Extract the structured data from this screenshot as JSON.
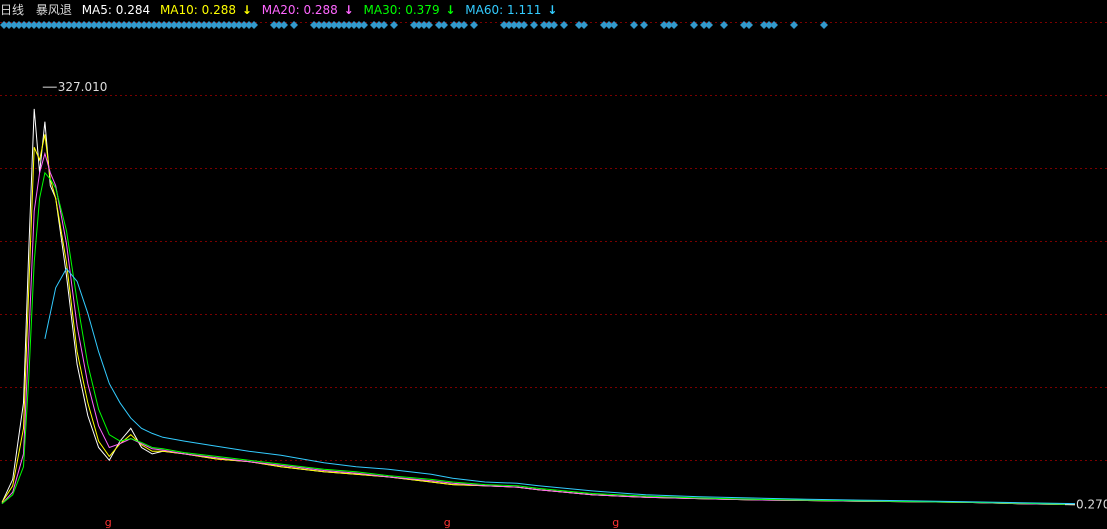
{
  "header": {
    "period_label": "日线",
    "indicator_name": "暴风退",
    "ma_items": [
      {
        "label": "MA5:",
        "value": "0.284",
        "arrow": "",
        "color": "#ffffff"
      },
      {
        "label": "MA10:",
        "value": "0.288",
        "arrow": "↓",
        "color": "#ffff00"
      },
      {
        "label": "MA20:",
        "value": "0.288",
        "arrow": "↓",
        "color": "#ff66ff"
      },
      {
        "label": "MA30:",
        "value": "0.379",
        "arrow": "↓",
        "color": "#00ff00"
      },
      {
        "label": "MA60:",
        "value": "1.111",
        "arrow": "↓",
        "color": "#33ccff"
      }
    ]
  },
  "chart_data": {
    "type": "line",
    "title": "",
    "xlabel": "",
    "ylabel": "",
    "ylim": [
      0,
      360
    ],
    "grid": true,
    "x": [
      0,
      0.01,
      0.02,
      0.025,
      0.03,
      0.035,
      0.04,
      0.045,
      0.05,
      0.06,
      0.07,
      0.08,
      0.09,
      0.1,
      0.11,
      0.12,
      0.13,
      0.14,
      0.15,
      0.17,
      0.2,
      0.23,
      0.26,
      0.28,
      0.3,
      0.33,
      0.36,
      0.4,
      0.42,
      0.45,
      0.48,
      0.5,
      0.55,
      0.6,
      0.65,
      0.7,
      0.75,
      0.8,
      0.85,
      0.9,
      0.95,
      1.0
    ],
    "series": [
      {
        "values": [
          2,
          20,
          80,
          200,
          310,
          260,
          300,
          250,
          240,
          180,
          110,
          70,
          45,
          35,
          50,
          60,
          45,
          40,
          42,
          40,
          36,
          34,
          30,
          28,
          26,
          24,
          22,
          18,
          16,
          15,
          14,
          12,
          8,
          6,
          5,
          4,
          3.5,
          3,
          2.5,
          2,
          1,
          0.28
        ],
        "color": "#ffffff"
      },
      {
        "values": [
          2,
          15,
          60,
          170,
          280,
          270,
          290,
          255,
          240,
          190,
          120,
          80,
          50,
          38,
          48,
          55,
          47,
          42,
          42,
          40,
          36,
          34,
          30,
          28,
          26,
          24,
          22,
          18,
          16,
          15,
          14,
          12,
          8,
          6,
          5,
          4,
          3.5,
          3,
          2.5,
          2,
          1,
          0.29
        ],
        "color": "#ffff00"
      },
      {
        "values": [
          1,
          10,
          40,
          130,
          230,
          260,
          275,
          260,
          250,
          205,
          140,
          95,
          62,
          45,
          48,
          52,
          48,
          44,
          43,
          40,
          37,
          34,
          31,
          29,
          27,
          25,
          22,
          19,
          17,
          15,
          14,
          12,
          8,
          6,
          5,
          4,
          3.5,
          3,
          2.5,
          2,
          1,
          0.29
        ],
        "color": "#ff66ff"
      },
      {
        "values": [
          1,
          8,
          30,
          100,
          190,
          240,
          260,
          255,
          248,
          215,
          160,
          110,
          75,
          55,
          50,
          52,
          49,
          45,
          44,
          41,
          38,
          35,
          32,
          30,
          28,
          26,
          23,
          20,
          18,
          16,
          15,
          13,
          9,
          7,
          5.5,
          4.5,
          3.8,
          3.2,
          2.7,
          2.2,
          1.3,
          0.38
        ],
        "color": "#00ff00"
      },
      {
        "values": [
          null,
          null,
          null,
          null,
          null,
          null,
          130,
          150,
          170,
          185,
          175,
          150,
          120,
          95,
          80,
          68,
          60,
          56,
          53,
          50,
          46,
          42,
          39,
          36,
          33,
          30,
          28,
          24,
          21,
          18,
          17,
          15,
          11,
          8,
          6.5,
          5.5,
          4.5,
          3.8,
          3.2,
          2.6,
          1.8,
          1.11
        ],
        "color": "#33ccff"
      }
    ],
    "annotations": [
      {
        "text": "327.010",
        "x": 0.038,
        "y": 327.01
      },
      {
        "text": "0.270",
        "x": 1.0,
        "y": 0.27
      }
    ],
    "signal_diamonds": [
      0.0,
      0.05,
      0.1,
      0.15,
      0.2,
      0.25,
      0.3,
      0.35,
      0.4,
      0.45,
      0.5,
      0.55,
      0.6,
      0.65,
      0.7,
      0.75,
      0.8,
      0.85,
      0.9,
      0.95,
      1.0,
      1.05,
      1.1,
      1.15,
      1.2,
      1.25,
      1.3,
      1.35,
      1.4,
      1.45,
      1.5,
      1.55,
      1.6,
      1.65,
      1.7,
      1.75,
      1.8,
      1.85,
      1.9,
      1.95,
      2.0,
      2.05,
      2.1,
      2.15,
      2.2,
      2.25,
      2.3,
      2.35,
      2.4,
      2.45,
      2.5,
      2.7,
      2.75,
      2.8,
      2.9,
      3.1,
      3.15,
      3.2,
      3.25,
      3.3,
      3.35,
      3.4,
      3.45,
      3.5,
      3.55,
      3.6,
      3.7,
      3.75,
      3.8,
      3.9,
      4.1,
      4.15,
      4.2,
      4.25,
      4.35,
      4.4,
      4.5,
      4.55,
      4.6,
      4.7,
      5.0,
      5.05,
      5.1,
      5.15,
      5.2,
      5.3,
      5.4,
      5.45,
      5.5,
      5.6,
      5.75,
      5.8,
      6.0,
      6.05,
      6.1,
      6.3,
      6.4,
      6.6,
      6.65,
      6.7,
      6.9,
      7.0,
      7.05,
      7.2,
      7.4,
      7.45,
      7.6,
      7.65,
      7.7,
      7.9,
      8.2
    ],
    "marker_labels": [
      {
        "text": "g",
        "x": 0.099
      },
      {
        "text": "g",
        "x": 0.415
      },
      {
        "text": "g",
        "x": 0.572
      }
    ],
    "colors": {
      "grid": "#7a0000",
      "diamond": "#3399cc",
      "marker": "#ff3333",
      "price_label": "#dcdcdc"
    }
  }
}
